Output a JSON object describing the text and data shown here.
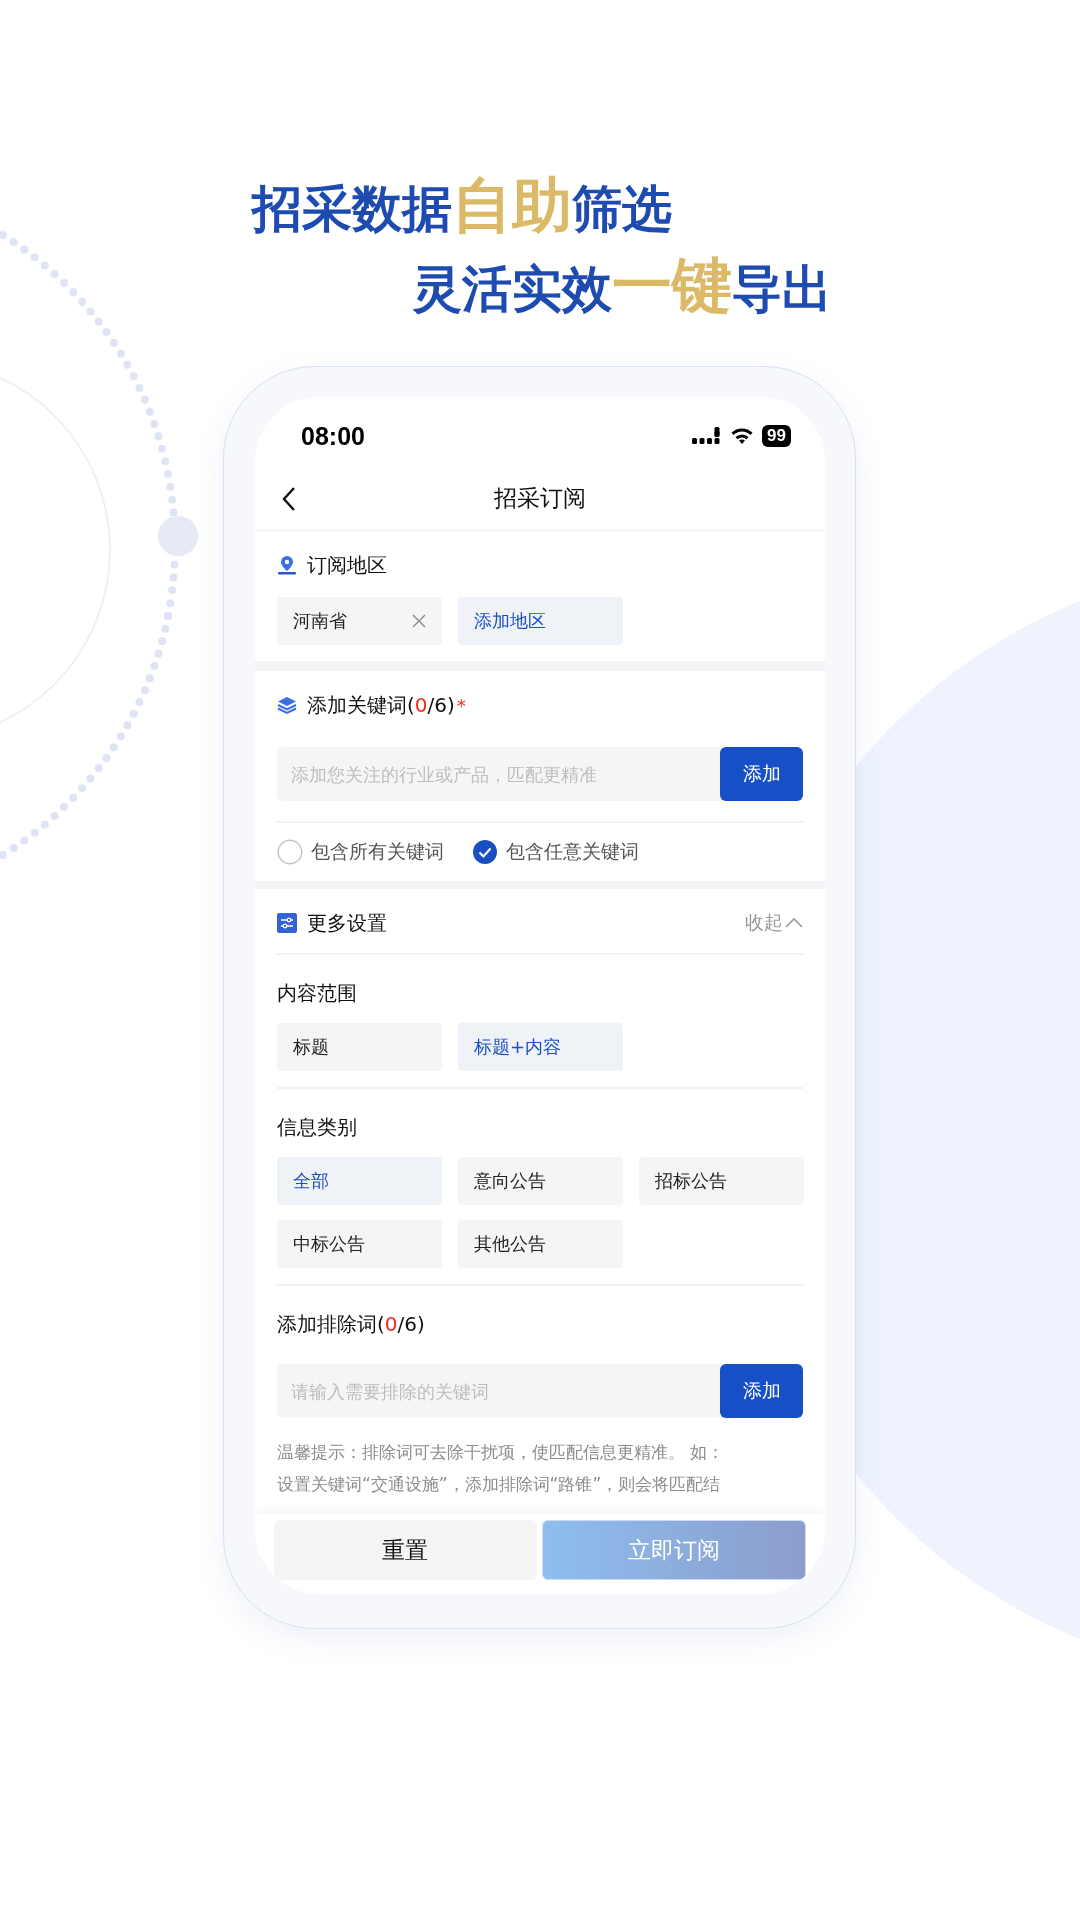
{
  "headline": [
    {
      "segments": [
        {
          "text": "招采数据",
          "accent": false
        },
        {
          "text": "自助",
          "accent": true
        },
        {
          "text": "筛选",
          "accent": false
        }
      ]
    },
    {
      "segments": [
        {
          "text": "灵活实效",
          "accent": false
        },
        {
          "text": "一键",
          "accent": true
        },
        {
          "text": "导出",
          "accent": false
        }
      ]
    }
  ],
  "status_bar": {
    "time": "08:00",
    "battery": "99"
  },
  "nav": {
    "title": "招采订阅"
  },
  "region": {
    "title": "订阅地区",
    "chips": [
      {
        "label": "河南省",
        "kind": "removable"
      },
      {
        "label": "添加地区",
        "kind": "add"
      }
    ]
  },
  "keywords": {
    "title_parts": [
      {
        "text": "添加关键词(",
        "highlight": false
      },
      {
        "text": "0",
        "highlight": true
      },
      {
        "text": "/6)",
        "highlight": false
      }
    ],
    "required_mark": "*",
    "placeholder": "添加您关注的行业或产品，匹配更精准",
    "button": "添加",
    "match_options": [
      {
        "label": "包含所有关键词",
        "selected": false
      },
      {
        "label": "包含任意关键词",
        "selected": true
      }
    ]
  },
  "more_settings": {
    "title": "更多设置",
    "collapse": "收起",
    "expanded": true,
    "content_scope": {
      "label": "内容范围",
      "options": [
        {
          "label": "标题",
          "selected": false
        },
        {
          "label": "标题+内容",
          "selected": true
        }
      ]
    },
    "info_category": {
      "label": "信息类别",
      "options": [
        {
          "label": "全部",
          "selected": true
        },
        {
          "label": "意向公告",
          "selected": false
        },
        {
          "label": "招标公告",
          "selected": false
        },
        {
          "label": "中标公告",
          "selected": false
        },
        {
          "label": "其他公告",
          "selected": false
        }
      ]
    },
    "exclude": {
      "title_parts": [
        {
          "text": "添加排除词(",
          "highlight": false
        },
        {
          "text": "0",
          "highlight": true
        },
        {
          "text": "/6)",
          "highlight": false
        }
      ],
      "placeholder": "请输入需要排除的关键词",
      "button": "添加"
    },
    "hint_lines": [
      "温馨提示：排除词可去除干扰项，使匹配信息更精准。 如：",
      "设置关键词“交通设施”，添加排除词“路锥”，则会将匹配结"
    ]
  },
  "footer": {
    "reset": "重置",
    "submit": "立即订阅",
    "submit_disabled": true
  }
}
